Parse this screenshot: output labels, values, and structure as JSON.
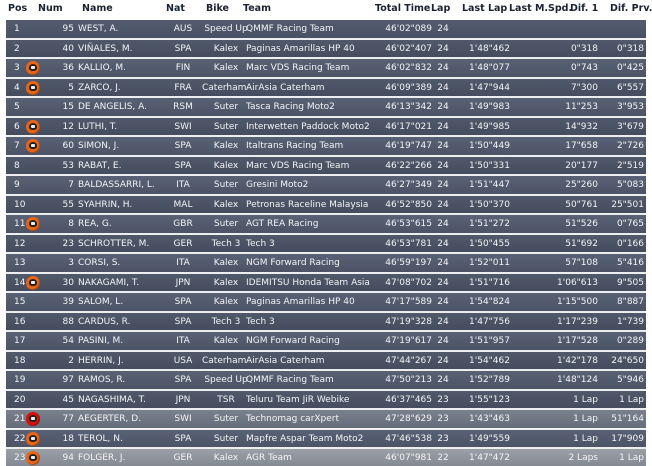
{
  "headers": {
    "pos": "Pos",
    "num": "Num",
    "name": "Name",
    "nat": "Nat",
    "bike": "Bike",
    "team": "Team",
    "total": "Total Time",
    "lap": "Lap",
    "lastlap": "Last Lap",
    "mspd": "Last M.Spd.",
    "dif1": "Dif. 1",
    "difprv": "Dif. Prv."
  },
  "icons": {
    "rider_helmet": "rider-helmet-icon",
    "orange": "#e86518",
    "red": "#d70f08"
  },
  "rows": [
    {
      "pos": "1",
      "num": "95",
      "name": "WEST, A.",
      "nat": "AUS",
      "bike": "Speed Up",
      "team": "QMMF Racing Team",
      "total": "46'02\"089",
      "lap": "24",
      "lastlap": "",
      "mspd": "",
      "dif1": "",
      "difprv": "",
      "icon": "none",
      "style": "selected"
    },
    {
      "pos": "2",
      "num": "40",
      "name": "VIÑALES, M.",
      "nat": "SPA",
      "bike": "Kalex",
      "team": "Paginas Amarillas HP 40",
      "total": "46'02\"407",
      "lap": "24",
      "lastlap": "1'48\"462",
      "mspd": "",
      "dif1": "0\"318",
      "difprv": "0\"318",
      "icon": "none",
      "style": "normal"
    },
    {
      "pos": "3",
      "num": "36",
      "name": "KALLIO, M.",
      "nat": "FIN",
      "bike": "Kalex",
      "team": "Marc VDS Racing Team",
      "total": "46'02\"832",
      "lap": "24",
      "lastlap": "1'48\"077",
      "mspd": "",
      "dif1": "0\"743",
      "difprv": "0\"425",
      "icon": "orange",
      "style": "alt"
    },
    {
      "pos": "4",
      "num": "5",
      "name": "ZARCO, J.",
      "nat": "FRA",
      "bike": "Caterham S",
      "team": "AirAsia Caterham",
      "total": "46'09\"389",
      "lap": "24",
      "lastlap": "1'47\"944",
      "mspd": "",
      "dif1": "7\"300",
      "difprv": "6\"557",
      "icon": "orange",
      "style": "normal"
    },
    {
      "pos": "5",
      "num": "15",
      "name": "DE ANGELIS, A.",
      "nat": "RSM",
      "bike": "Suter",
      "team": "Tasca Racing Moto2",
      "total": "46'13\"342",
      "lap": "24",
      "lastlap": "1'49\"983",
      "mspd": "",
      "dif1": "11\"253",
      "difprv": "3\"953",
      "icon": "none",
      "style": "alt"
    },
    {
      "pos": "6",
      "num": "12",
      "name": "LUTHI, T.",
      "nat": "SWI",
      "bike": "Suter",
      "team": "Interwetten Paddock Moto2",
      "total": "46'17\"021",
      "lap": "24",
      "lastlap": "1'49\"985",
      "mspd": "",
      "dif1": "14\"932",
      "difprv": "3\"679",
      "icon": "orange",
      "style": "normal"
    },
    {
      "pos": "7",
      "num": "60",
      "name": "SIMON, J.",
      "nat": "SPA",
      "bike": "Kalex",
      "team": "Italtrans Racing Team",
      "total": "46'19\"747",
      "lap": "24",
      "lastlap": "1'50\"449",
      "mspd": "",
      "dif1": "17\"658",
      "difprv": "2\"726",
      "icon": "orange",
      "style": "alt"
    },
    {
      "pos": "8",
      "num": "53",
      "name": "RABAT, E.",
      "nat": "SPA",
      "bike": "Kalex",
      "team": "Marc VDS Racing Team",
      "total": "46'22\"266",
      "lap": "24",
      "lastlap": "1'50\"331",
      "mspd": "",
      "dif1": "20\"177",
      "difprv": "2\"519",
      "icon": "none",
      "style": "normal"
    },
    {
      "pos": "9",
      "num": "7",
      "name": "BALDASSARRI, L.",
      "nat": "ITA",
      "bike": "Suter",
      "team": "Gresini Moto2",
      "total": "46'27\"349",
      "lap": "24",
      "lastlap": "1'51\"447",
      "mspd": "",
      "dif1": "25\"260",
      "difprv": "5\"083",
      "icon": "none",
      "style": "alt"
    },
    {
      "pos": "10",
      "num": "55",
      "name": "SYAHRIN, H.",
      "nat": "MAL",
      "bike": "Kalex",
      "team": "Petronas Raceline Malaysia",
      "total": "46'52\"850",
      "lap": "24",
      "lastlap": "1'50\"370",
      "mspd": "",
      "dif1": "50\"761",
      "difprv": "25\"501",
      "icon": "none",
      "style": "normal"
    },
    {
      "pos": "11",
      "num": "8",
      "name": "REA, G.",
      "nat": "GBR",
      "bike": "Suter",
      "team": "AGT REA Racing",
      "total": "46'53\"615",
      "lap": "24",
      "lastlap": "1'51\"272",
      "mspd": "",
      "dif1": "51\"526",
      "difprv": "0\"765",
      "icon": "orange",
      "style": "alt"
    },
    {
      "pos": "12",
      "num": "23",
      "name": "SCHROTTER, M.",
      "nat": "GER",
      "bike": "Tech 3",
      "team": "Tech 3",
      "total": "46'53\"781",
      "lap": "24",
      "lastlap": "1'50\"455",
      "mspd": "",
      "dif1": "51\"692",
      "difprv": "0\"166",
      "icon": "none",
      "style": "normal"
    },
    {
      "pos": "13",
      "num": "3",
      "name": "CORSI, S.",
      "nat": "ITA",
      "bike": "Kalex",
      "team": "NGM Forward Racing",
      "total": "46'59\"197",
      "lap": "24",
      "lastlap": "1'52\"011",
      "mspd": "",
      "dif1": "57\"108",
      "difprv": "5\"416",
      "icon": "none",
      "style": "alt"
    },
    {
      "pos": "14",
      "num": "30",
      "name": "NAKAGAMI, T.",
      "nat": "JPN",
      "bike": "Kalex",
      "team": "IDEMITSU Honda Team Asia",
      "total": "47'08\"702",
      "lap": "24",
      "lastlap": "1'51\"716",
      "mspd": "",
      "dif1": "1'06\"613",
      "difprv": "9\"505",
      "icon": "orange",
      "style": "normal"
    },
    {
      "pos": "15",
      "num": "39",
      "name": "SALOM, L.",
      "nat": "SPA",
      "bike": "Kalex",
      "team": "Paginas Amarillas HP 40",
      "total": "47'17\"589",
      "lap": "24",
      "lastlap": "1'54\"824",
      "mspd": "",
      "dif1": "1'15\"500",
      "difprv": "8\"887",
      "icon": "none",
      "style": "alt"
    },
    {
      "pos": "16",
      "num": "88",
      "name": "CARDUS, R.",
      "nat": "SPA",
      "bike": "Tech 3",
      "team": "Tech 3",
      "total": "47'19\"328",
      "lap": "24",
      "lastlap": "1'47\"756",
      "mspd": "",
      "dif1": "1'17\"239",
      "difprv": "1\"739",
      "icon": "none",
      "style": "normal"
    },
    {
      "pos": "17",
      "num": "54",
      "name": "PASINI, M.",
      "nat": "ITA",
      "bike": "Kalex",
      "team": "NGM Forward Racing",
      "total": "47'19\"617",
      "lap": "24",
      "lastlap": "1'51\"957",
      "mspd": "",
      "dif1": "1'17\"528",
      "difprv": "0\"289",
      "icon": "none",
      "style": "alt"
    },
    {
      "pos": "18",
      "num": "2",
      "name": "HERRIN, J.",
      "nat": "USA",
      "bike": "Caterham S",
      "team": "AirAsia Caterham",
      "total": "47'44\"267",
      "lap": "24",
      "lastlap": "1'54\"462",
      "mspd": "",
      "dif1": "1'42\"178",
      "difprv": "24\"650",
      "icon": "none",
      "style": "normal"
    },
    {
      "pos": "19",
      "num": "97",
      "name": "RAMOS, R.",
      "nat": "SPA",
      "bike": "Speed Up",
      "team": "QMMF Racing Team",
      "total": "47'50\"213",
      "lap": "24",
      "lastlap": "1'52\"789",
      "mspd": "",
      "dif1": "1'48\"124",
      "difprv": "5\"946",
      "icon": "none",
      "style": "alt"
    },
    {
      "pos": "20",
      "num": "45",
      "name": "NAGASHIMA, T.",
      "nat": "JPN",
      "bike": "TSR",
      "team": "Teluru Team JiR Webike",
      "total": "46'37\"465",
      "lap": "23",
      "lastlap": "1'55\"123",
      "mspd": "",
      "dif1": "1 Lap",
      "difprv": "1 Lap",
      "icon": "none",
      "style": "normal"
    },
    {
      "pos": "21",
      "num": "77",
      "name": "AEGERTER, D.",
      "nat": "SWI",
      "bike": "Suter",
      "team": "Technomag carXpert",
      "total": "47'28\"629",
      "lap": "23",
      "lastlap": "1'43\"463",
      "mspd": "",
      "dif1": "1 Lap",
      "difprv": "51\"164",
      "icon": "red",
      "style": "lapped"
    },
    {
      "pos": "22",
      "num": "18",
      "name": "TEROL, N.",
      "nat": "SPA",
      "bike": "Suter",
      "team": "Mapfre Aspar Team Moto2",
      "total": "47'46\"538",
      "lap": "23",
      "lastlap": "1'49\"559",
      "mspd": "",
      "dif1": "1 Lap",
      "difprv": "17\"909",
      "icon": "orange",
      "style": "alt"
    },
    {
      "pos": "23",
      "num": "94",
      "name": "FOLGER, J.",
      "nat": "GER",
      "bike": "Kalex",
      "team": "AGR Team",
      "total": "46'07\"981",
      "lap": "22",
      "lastlap": "1'47\"472",
      "mspd": "",
      "dif1": "2 Laps",
      "difprv": "1 Lap",
      "icon": "orange",
      "style": "last"
    }
  ]
}
